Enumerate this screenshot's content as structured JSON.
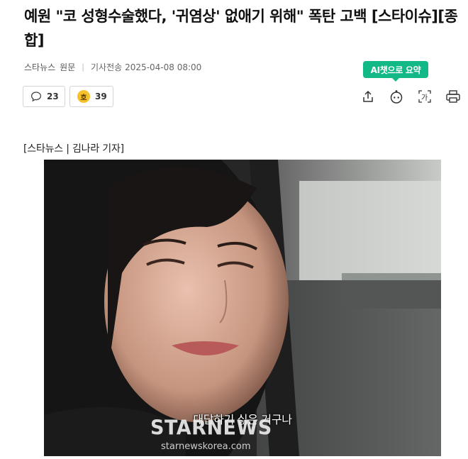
{
  "article": {
    "headline": "예원 \"코 성형수술했다, '귀염상' 없애기 위해\" 폭탄 고백 [스타이슈][종합]",
    "source": "스타뉴스",
    "source_link": "원문",
    "published_label": "기사전송",
    "published_at": "2025-04-08 08:00",
    "byline": "[스타뉴스 | 김나라 기자]"
  },
  "reactions": {
    "comment_count": "23",
    "like_count": "39",
    "like_icon_glyph": "호"
  },
  "toolbar": {
    "ai_summary_label": "AI챗으로 요약",
    "icons": [
      "share-icon",
      "ai-chat-icon",
      "font-size-icon",
      "print-icon"
    ]
  },
  "photo": {
    "caption": "대답하기 싫은 거구나",
    "watermark_brand": "STARNEWS",
    "watermark_url": "starnewskorea.com"
  },
  "colors": {
    "accent": "#12b886",
    "coin": "#f6c12d",
    "text": "#111111",
    "meta": "#555555"
  }
}
